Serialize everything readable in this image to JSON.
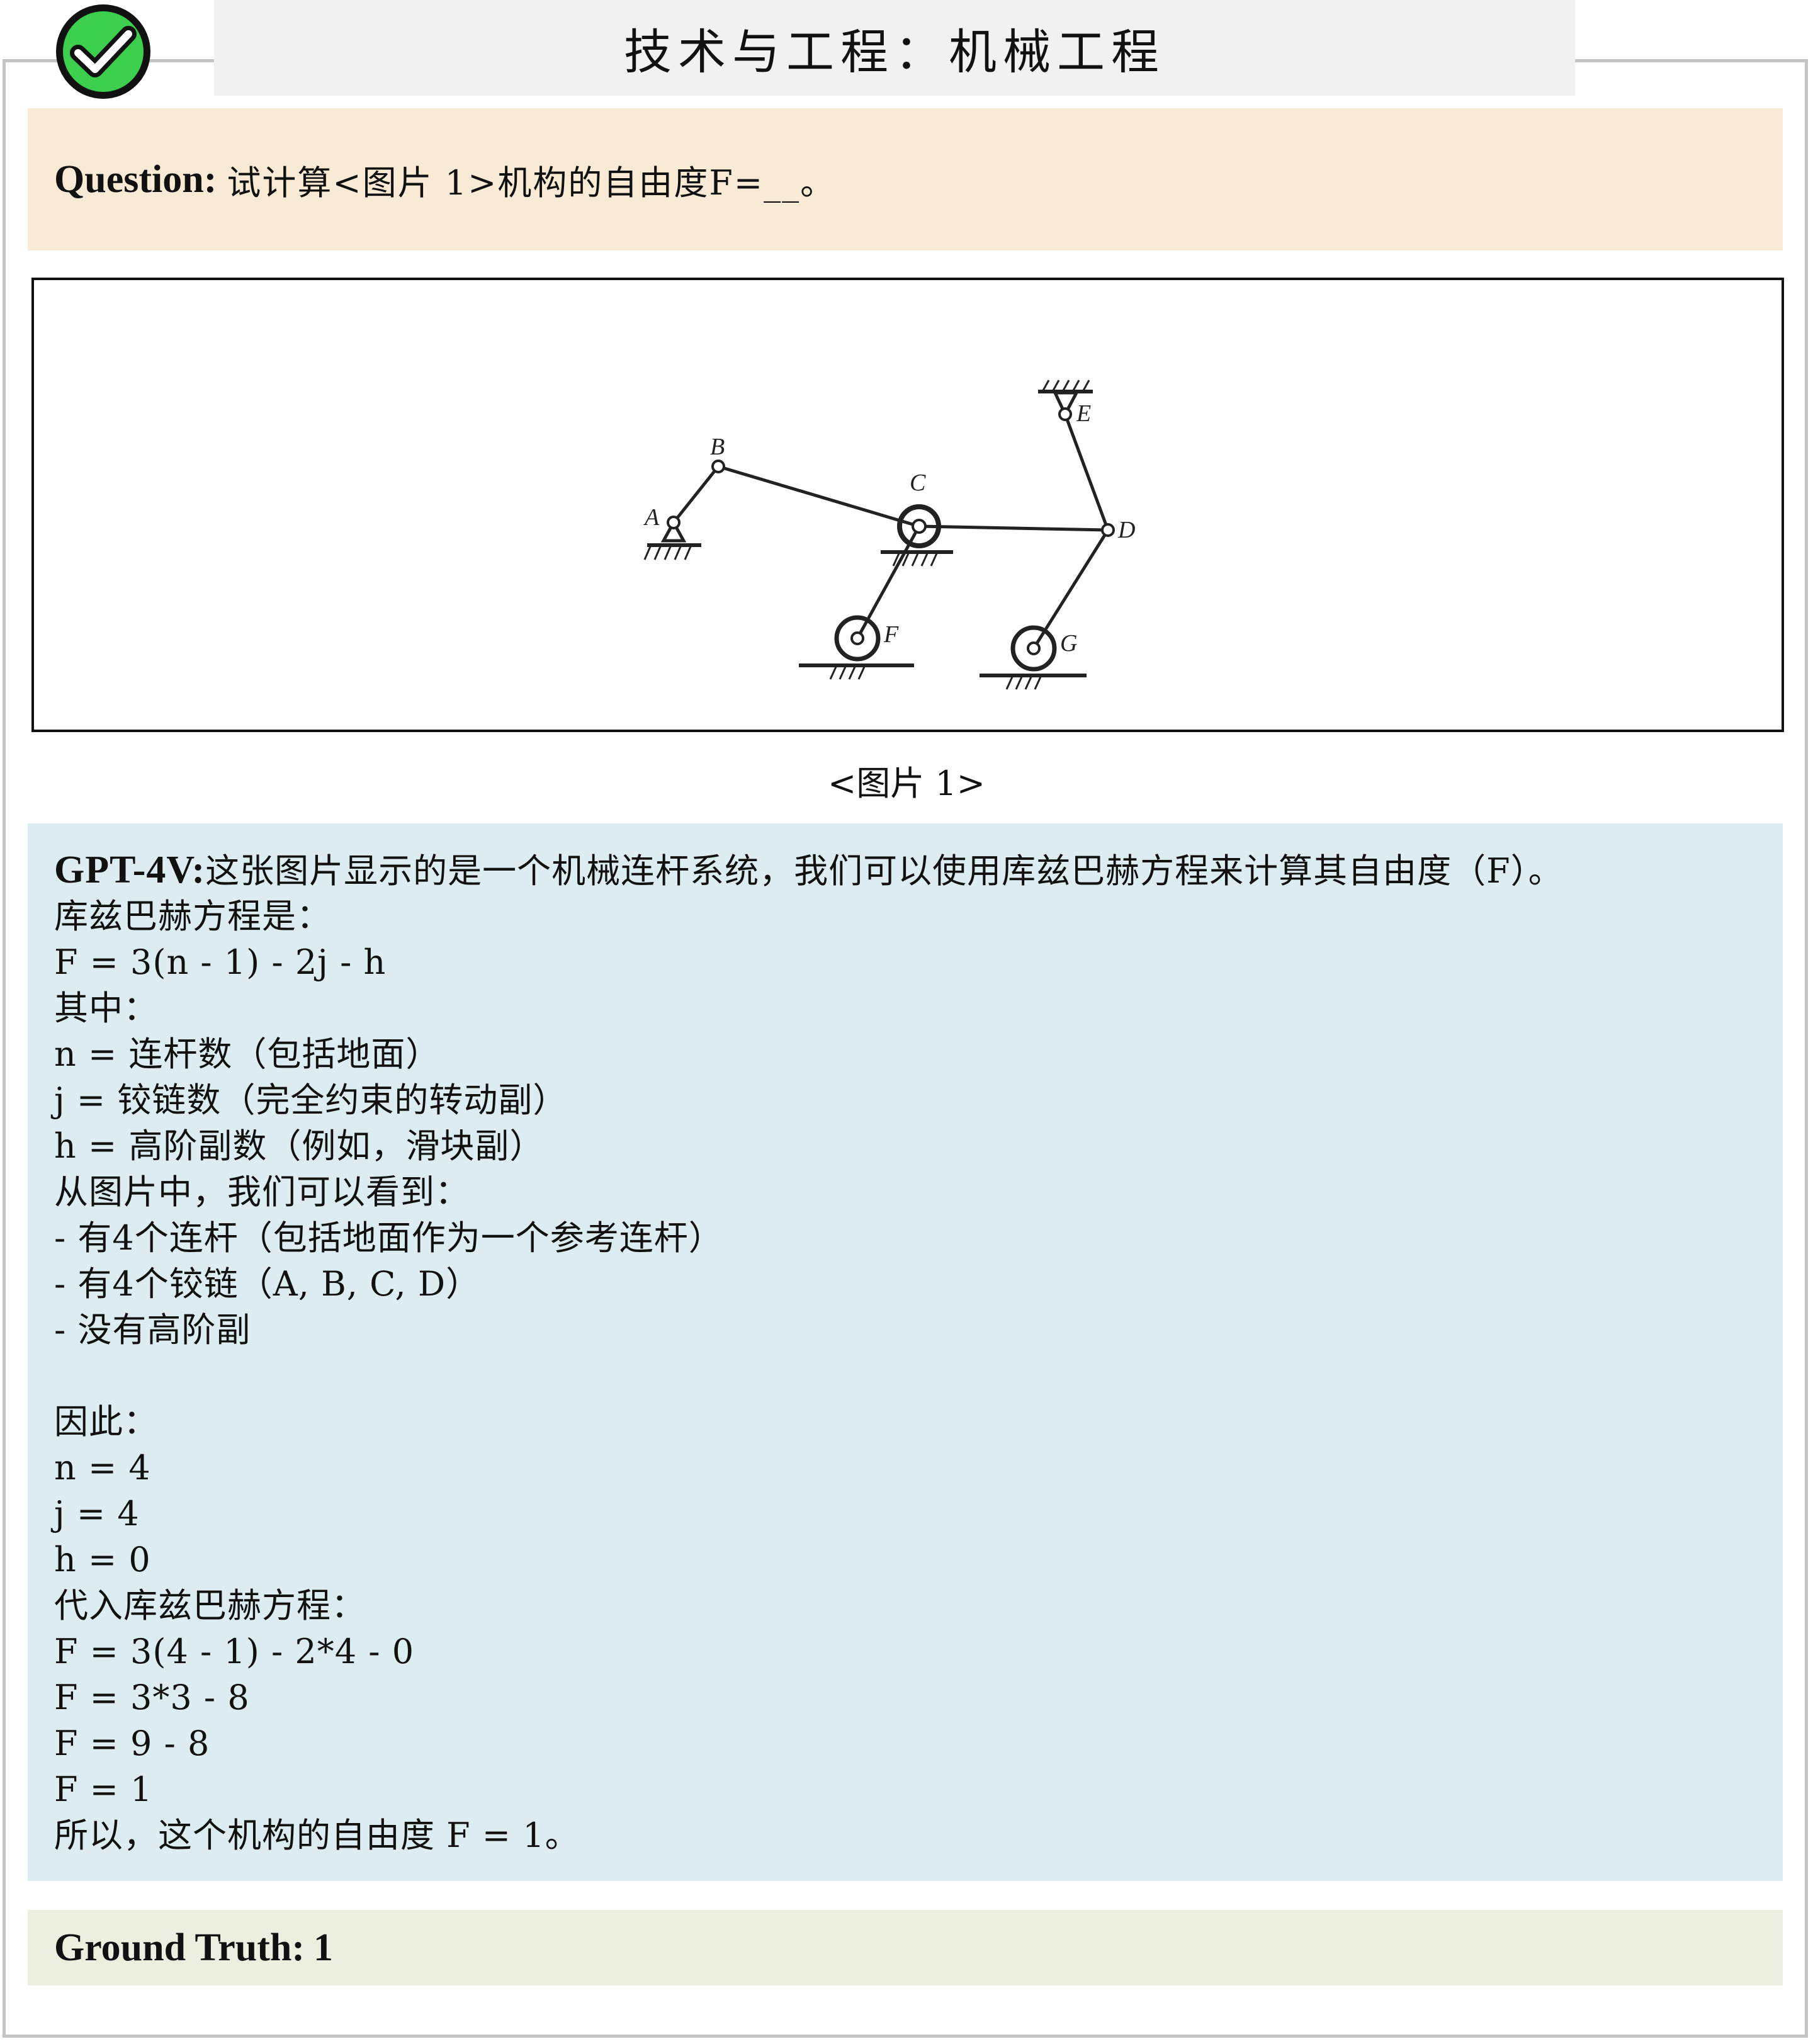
{
  "header": {
    "title": "技术与工程：机械工程",
    "badge_icon": "check-circle-icon",
    "badge_color": "#3ccf4e"
  },
  "question": {
    "label": "Question:",
    "text": "试计算<图片 1>机构的自由度F=__。"
  },
  "figure": {
    "caption": "<图片 1>",
    "labels": {
      "A": "A",
      "B": "B",
      "C": "C",
      "D": "D",
      "E": "E",
      "F": "F",
      "G": "G"
    }
  },
  "answer": {
    "label": "GPT-4V:",
    "first_line": "这张图片显示的是一个机械连杆系统，我们可以使用库兹巴赫方程来计算其自由度（F）。",
    "lines": [
      "库兹巴赫方程是：",
      "F = 3(n - 1) - 2j - h",
      "其中：",
      "n = 连杆数（包括地面）",
      "j = 铰链数（完全约束的转动副）",
      "h = 高阶副数（例如，滑块副）",
      "从图片中，我们可以看到：",
      "- 有4个连杆（包括地面作为一个参考连杆）",
      "- 有4个铰链（A, B, C, D）",
      "- 没有高阶副",
      "",
      "因此：",
      "n = 4",
      "j = 4",
      "h = 0",
      "代入库兹巴赫方程：",
      "F = 3(4 - 1) - 2*4 - 0",
      "F = 3*3 - 8",
      "F = 9 - 8",
      "F = 1",
      "所以，这个机构的自由度 F = 1。"
    ]
  },
  "ground_truth": {
    "label": "Ground Truth:",
    "value": "1"
  },
  "colors": {
    "question_bg": "#f8ead5",
    "answer_bg": "#dcecf0",
    "ground_truth_bg": "#ecefe0",
    "frame": "#c4c4c4"
  }
}
